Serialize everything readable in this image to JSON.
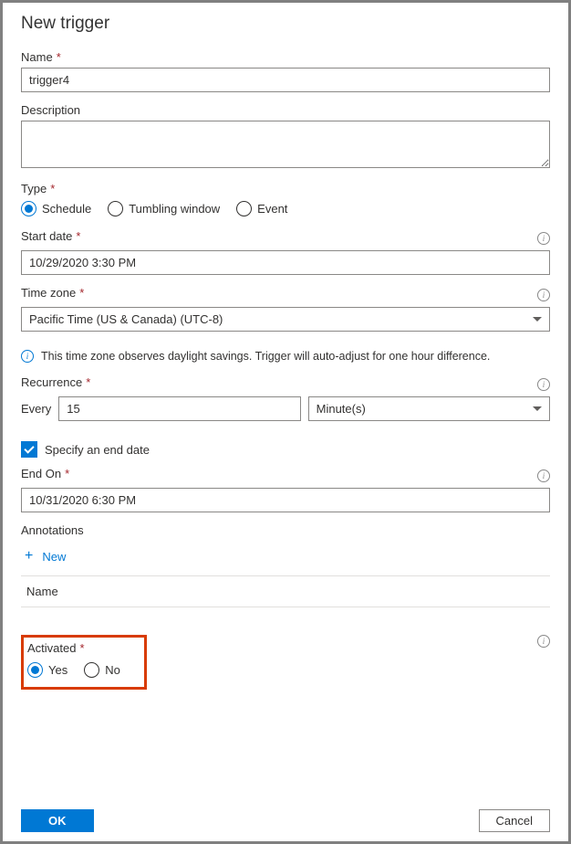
{
  "panel": {
    "title": "New trigger"
  },
  "name": {
    "label": "Name",
    "value": "trigger4"
  },
  "description": {
    "label": "Description",
    "value": ""
  },
  "type": {
    "label": "Type",
    "options": {
      "schedule": "Schedule",
      "tumbling": "Tumbling window",
      "event": "Event"
    }
  },
  "start_date": {
    "label": "Start date",
    "value": "10/29/2020 3:30 PM"
  },
  "time_zone": {
    "label": "Time zone",
    "value": "Pacific Time (US & Canada) (UTC-8)"
  },
  "dst_note": "This time zone observes daylight savings. Trigger will auto-adjust for one hour difference.",
  "recurrence": {
    "label": "Recurrence",
    "every_label": "Every",
    "value": "15",
    "unit": "Minute(s)"
  },
  "specify_end": {
    "label": "Specify an end date",
    "checked": true
  },
  "end_on": {
    "label": "End On",
    "value": "10/31/2020 6:30 PM"
  },
  "annotations": {
    "label": "Annotations",
    "new_label": "New",
    "col_name": "Name"
  },
  "activated": {
    "label": "Activated",
    "yes": "Yes",
    "no": "No"
  },
  "footer": {
    "ok": "OK",
    "cancel": "Cancel"
  }
}
